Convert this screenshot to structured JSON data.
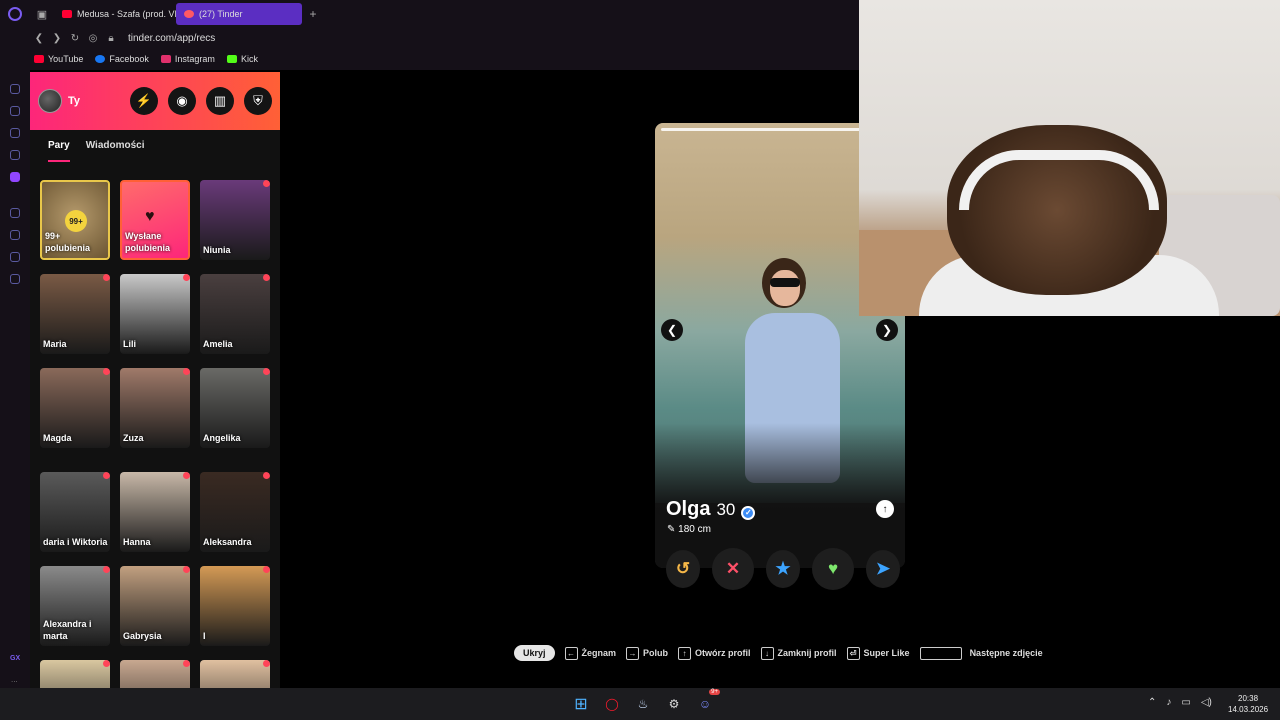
{
  "browser": {
    "tabs": [
      {
        "label": "Medusa - Szafa (prod. VB",
        "color": "#ff0033"
      },
      {
        "label": "(27) Tinder",
        "color": "#ff5864",
        "active": true
      }
    ],
    "url": "tinder.com/app/recs",
    "bookmarks": [
      {
        "label": "YouTube",
        "color": "#ff0033"
      },
      {
        "label": "Facebook",
        "color": "#1877f2"
      },
      {
        "label": "Instagram",
        "color": "#e1306c"
      },
      {
        "label": "Kick",
        "color": "#53fc18"
      }
    ],
    "sidebar_footer": "GX",
    "more": "..."
  },
  "tinder": {
    "profile_label": "Ty",
    "tabs": [
      "Pary",
      "Wiadomości"
    ],
    "likes_card": {
      "count": "99+",
      "label": "99+ polubienia"
    },
    "sent_card": {
      "label": "Wysłane polubienia"
    },
    "matches": [
      "Niunia",
      "Maria",
      "Lili",
      "Amelia",
      "Magda",
      "Zuza",
      "Angelika",
      "daria i Wiktoria",
      "Hanna",
      "Aleksandra",
      "Alexandra i marta",
      "Gabrysia",
      "I",
      "",
      "",
      ""
    ]
  },
  "card": {
    "name": "Olga",
    "age": "30",
    "height": "180 cm"
  },
  "hints": {
    "hide": "Ukryj",
    "items": [
      {
        "key": "←",
        "label": "Żegnam"
      },
      {
        "key": "→",
        "label": "Polub"
      },
      {
        "key": "↑",
        "label": "Otwórz profil"
      },
      {
        "key": "↓",
        "label": "Zamknij profil"
      },
      {
        "key": "⏎",
        "label": "Super Like"
      },
      {
        "key": "",
        "label": "Następne zdjęcie"
      }
    ]
  },
  "taskbar": {
    "discord_badge": "9+",
    "time": "20:38",
    "date": "14.03.2026"
  },
  "colors": {
    "brand_start": "#fd267a",
    "brand_end": "#ff6036",
    "active_tab": "#5b2ec2"
  }
}
